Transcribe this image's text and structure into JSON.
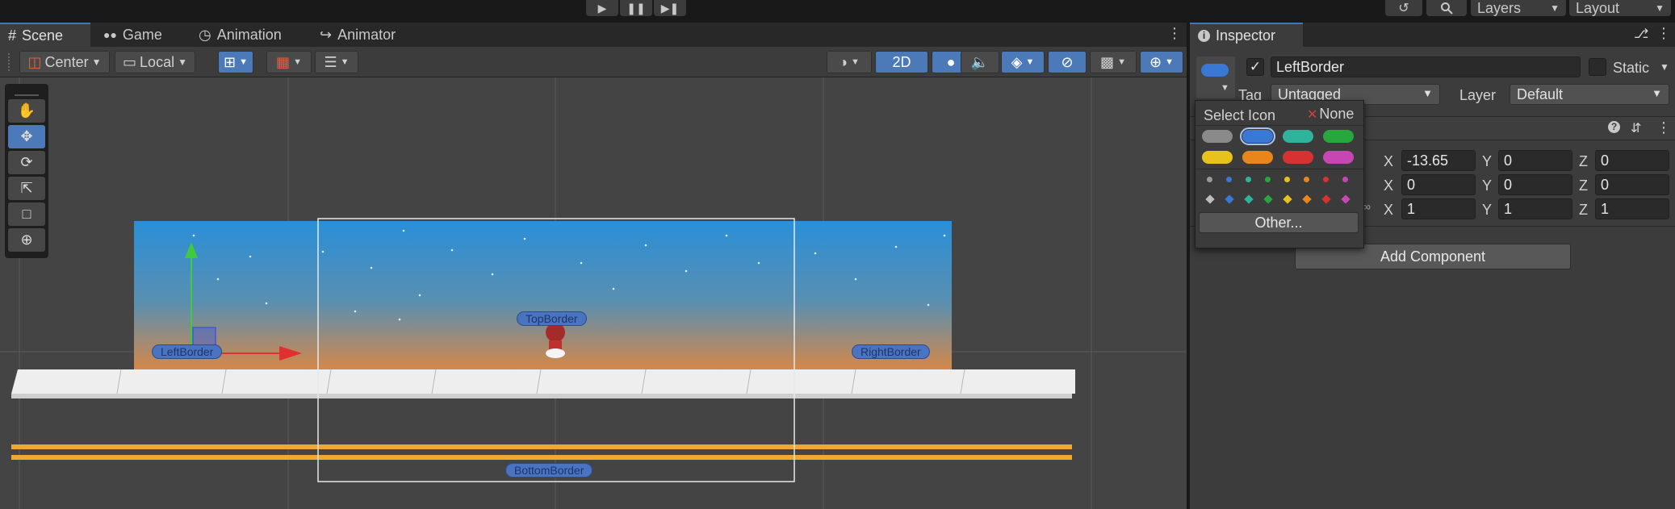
{
  "playbar": {
    "play_icon": "play-icon",
    "pause_icon": "pause-icon",
    "step_icon": "step-icon"
  },
  "top_right": {
    "history_icon": "history-icon",
    "search_icon": "search-icon",
    "layers_label": "Layers",
    "layout_label": "Layout"
  },
  "scene_tabs": [
    {
      "label": "Scene",
      "icon": "grid-icon",
      "active": true
    },
    {
      "label": "Game",
      "icon": "gamepad-icon",
      "active": false
    },
    {
      "label": "Animation",
      "icon": "clock-icon",
      "active": false
    },
    {
      "label": "Animator",
      "icon": "animator-icon",
      "active": false
    }
  ],
  "toolbar": {
    "pivot_label": "Center",
    "space_label": "Local",
    "mode_2d_label": "2D"
  },
  "scene_labels": {
    "top_border": "TopBorder",
    "left_border": "LeftBorder",
    "right_border": "RightBorder",
    "bottom_border": "BottomBorder"
  },
  "inspector": {
    "tab_label": "Inspector",
    "object_name": "LeftBorder",
    "active_checked": true,
    "static_label": "Static",
    "tag_label": "Tag",
    "tag_value": "Untagged",
    "layer_label": "Layer",
    "layer_value": "Default",
    "position": {
      "x": "-13.65",
      "y": "0",
      "z": "0"
    },
    "rotation": {
      "x": "0",
      "y": "0",
      "z": "0"
    },
    "scale": {
      "x": "1",
      "y": "1",
      "z": "1"
    },
    "axis_x": "X",
    "axis_y": "Y",
    "axis_z": "Z",
    "add_component_label": "Add Component"
  },
  "icon_popup": {
    "title": "Select Icon",
    "none_label": "None",
    "other_label": "Other...",
    "label_colors": [
      "#8a8a8a",
      "#3a78d6",
      "#2fb39a",
      "#28a83c",
      "#e8c21c",
      "#e8861c",
      "#d63232",
      "#c646b4"
    ],
    "selected_color": "#3a78d6"
  },
  "colors": {
    "accent": "#4c7ab8",
    "sky_top": "#2e8fd6",
    "sky_bottom": "#d48a4c",
    "stripe": "#f0a830"
  }
}
